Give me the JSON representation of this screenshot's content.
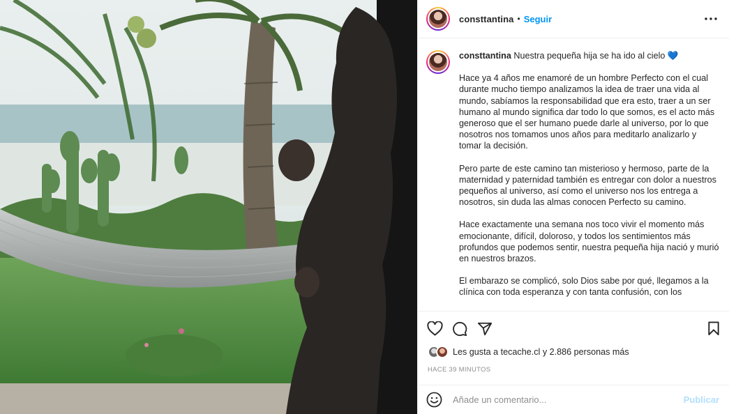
{
  "post": {
    "username": "consttantina",
    "follow_label": "Seguir",
    "more_icon": "more-horizontal-icon",
    "photo_description_icon": "photo"
  },
  "caption": {
    "username": "consttantina",
    "headline": "Nuestra pequeña hija se ha ido al cielo",
    "headline_emoji": "💙",
    "paragraphs": [
      "Hace ya 4 años me enamoré de un hombre Perfecto con el cual durante mucho tiempo analizamos la idea de traer una vida al mundo, sabíamos la responsabilidad que era esto, traer a un ser humano al mundo significa dar todo lo que somos, es el acto más generoso que el ser humano puede darle al universo, por lo que nosotros nos tomamos unos años para meditarlo analizarlo y tomar la decisión.",
      "Pero parte de este camino tan misterioso y hermoso, parte de la maternidad y paternidad también es entregar con dolor a nuestros pequeños al universo, así como el universo nos los entrega a nosotros, sin duda las almas conocen Perfecto su camino.",
      "Hace exactamente una semana nos toco vivir el momento más emocionante, difícil, doloroso, y todos los sentimientos más profundos que podemos sentir, nuestra pequeña hija nació y murió en nuestros brazos.",
      "El embarazo se complicó, solo Dios sabe por qué, llegamos a la clínica con toda esperanza y con tanta confusión, con los"
    ]
  },
  "likes": {
    "text": "Les gusta a tecache.cl y 2.886 personas más"
  },
  "timestamp": "HACE 39 MINUTOS",
  "comment": {
    "placeholder": "Añade un comentario...",
    "publish_label": "Publicar"
  },
  "colors": {
    "accent": "#0095f6",
    "publish_disabled": "#b2dffc",
    "border": "#efefef"
  }
}
